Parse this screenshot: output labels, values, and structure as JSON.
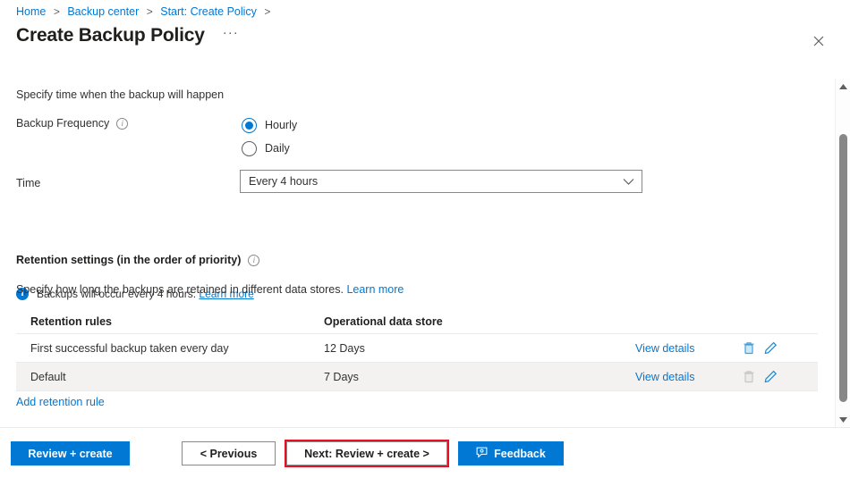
{
  "breadcrumb": {
    "items": [
      {
        "label": "Home"
      },
      {
        "label": "Backup center"
      },
      {
        "label": "Start: Create Policy"
      }
    ],
    "separator": ">"
  },
  "header": {
    "title": "Create Backup Policy",
    "more_menu": "···",
    "close_icon": "✕"
  },
  "form": {
    "section_intro": "Specify time when the backup will happen",
    "frequency_label": "Backup Frequency",
    "frequency_options": [
      {
        "label": "Hourly",
        "selected": true
      },
      {
        "label": "Daily",
        "selected": false
      }
    ],
    "time_label": "Time",
    "time_value": "Every 4 hours",
    "info_message": "Backups will occur every 4 hours.",
    "info_link": "Learn more"
  },
  "retention": {
    "heading": "Retention settings (in the order of priority)",
    "subtitle": "Specify how long the backups are retained in different data stores.",
    "subtitle_link": "Learn more",
    "columns": [
      "Retention rules",
      "Operational data store"
    ],
    "rows": [
      {
        "name": "First successful backup taken every day",
        "store": "12 Days",
        "view_details": "View details",
        "delete_enabled": true
      },
      {
        "name": "Default",
        "store": "7 Days",
        "view_details": "View details",
        "delete_enabled": false
      }
    ],
    "add_rule_link": "Add retention rule"
  },
  "footer": {
    "review_create": "Review + create",
    "previous": "< Previous",
    "next": "Next: Review + create >",
    "feedback": "Feedback"
  },
  "colors": {
    "accent": "#0078d4",
    "link": "#0078d4",
    "highlight_border": "#e81123",
    "row_alt": "#f3f2f1",
    "disabled_icon": "#c8c6c4"
  }
}
